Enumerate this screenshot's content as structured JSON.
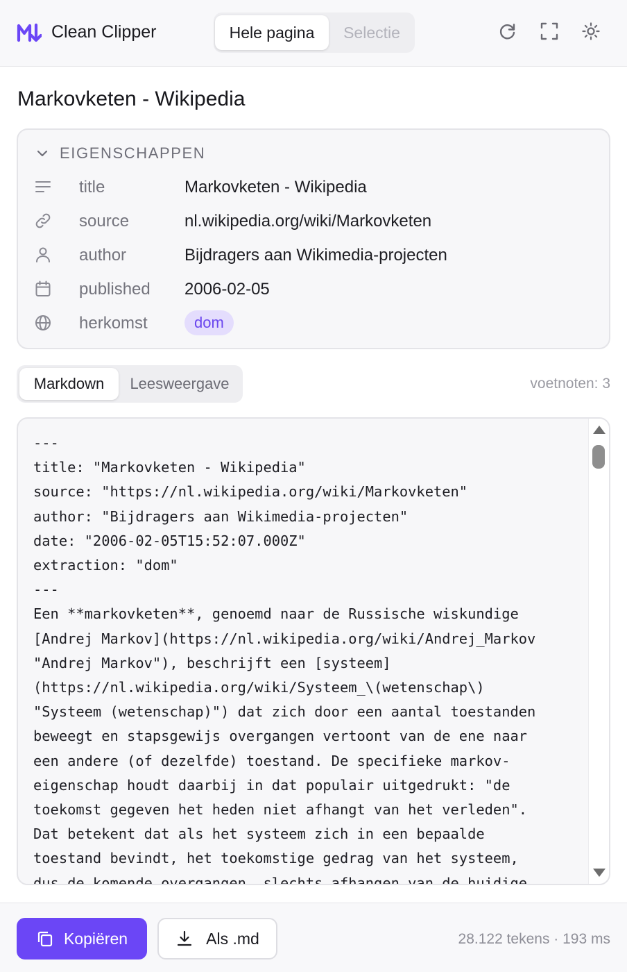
{
  "header": {
    "app_title": "Clean Clipper",
    "logo_icon": "markdown-logo-icon",
    "mode_tabs": [
      {
        "label": "Hele pagina",
        "active": true
      },
      {
        "label": "Selectie",
        "active": false
      }
    ],
    "icons": [
      "refresh-icon",
      "fullscreen-icon",
      "sun-icon"
    ]
  },
  "page": {
    "title": "Markovketen - Wikipedia"
  },
  "properties": {
    "heading": "EIGENSCHAPPEN",
    "rows": [
      {
        "icon": "text-lines-icon",
        "key": "title",
        "value": "Markovketen - Wikipedia"
      },
      {
        "icon": "link-icon",
        "key": "source",
        "value": "nl.wikipedia.org/wiki/Markovketen"
      },
      {
        "icon": "user-icon",
        "key": "author",
        "value": "Bijdragers aan Wikimedia-projecten"
      },
      {
        "icon": "calendar-icon",
        "key": "published",
        "value": "2006-02-05"
      },
      {
        "icon": "globe-icon",
        "key": "herkomst",
        "value": "dom",
        "badge": true
      }
    ]
  },
  "view_tabs": [
    {
      "label": "Markdown",
      "active": true
    },
    {
      "label": "Leesweergave",
      "active": false
    }
  ],
  "footnotes": "voetnoten: 3",
  "code": {
    "lines": [
      "---",
      "title: \"Markovketen - Wikipedia\"",
      "source: \"https://nl.wikipedia.org/wiki/Markovketen\"",
      "author: \"Bijdragers aan Wikimedia-projecten\"",
      "date: \"2006-02-05T15:52:07.000Z\"",
      "extraction: \"dom\"",
      "---",
      "Een **markovketen**, genoemd naar de Russische wiskundige",
      "[Andrej Markov](https://nl.wikipedia.org/wiki/Andrej_Markov",
      "\"Andrej Markov\"), beschrijft een [systeem]",
      "(https://nl.wikipedia.org/wiki/Systeem_\\(wetenschap\\)",
      "\"Systeem (wetenschap)\") dat zich door een aantal toestanden",
      "beweegt en stapsgewijs overgangen vertoont van de ene naar",
      "een andere (of dezelfde) toestand. De specifieke markov-",
      "eigenschap houdt daarbij in dat populair uitgedrukt: \"de",
      "toekomst gegeven het heden niet afhangt van het verleden\".",
      "Dat betekent dat als het systeem zich in een bepaalde",
      "toestand bevindt, het toekomstige gedrag van het systeem,",
      "dus de komende overgangen, slechts afhangen van de huidige"
    ]
  },
  "footer": {
    "copy_label": "Kopiëren",
    "download_label": "Als .md",
    "stats": "28.122 tekens · 193 ms"
  },
  "colors": {
    "accent": "#6b46f6",
    "badge_bg": "#e4ddfd",
    "badge_text": "#6a46ee"
  }
}
